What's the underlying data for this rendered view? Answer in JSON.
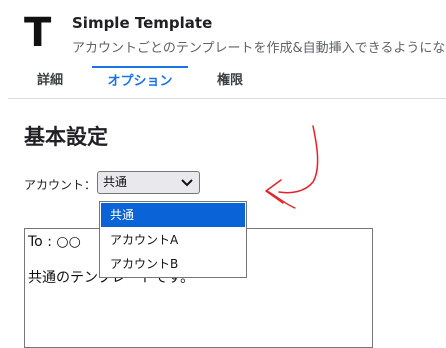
{
  "header": {
    "logo": "T",
    "title": "Simple Template",
    "description": "アカウントごとのテンプレートを作成&自動挿入できるようにな"
  },
  "tabs": [
    {
      "label": "詳細",
      "active": false
    },
    {
      "label": "オプション",
      "active": true
    },
    {
      "label": "権限",
      "active": false
    }
  ],
  "main": {
    "section_title": "基本設定",
    "account_label": "アカウント：",
    "account_select": {
      "value": "共通",
      "options": [
        "共通",
        "アカウントA",
        "アカウントB"
      ],
      "highlighted_index": 0
    },
    "template_text": "To : ○○\n\n共通のテンプレートです。"
  },
  "colors": {
    "accent": "#1a73e8",
    "dropdown_highlight": "#0a64d8",
    "annotation": "#e8202a"
  },
  "icons": {
    "select_arrow": "chevron-down-icon",
    "annotation": "red-hand-drawn-arrow"
  }
}
